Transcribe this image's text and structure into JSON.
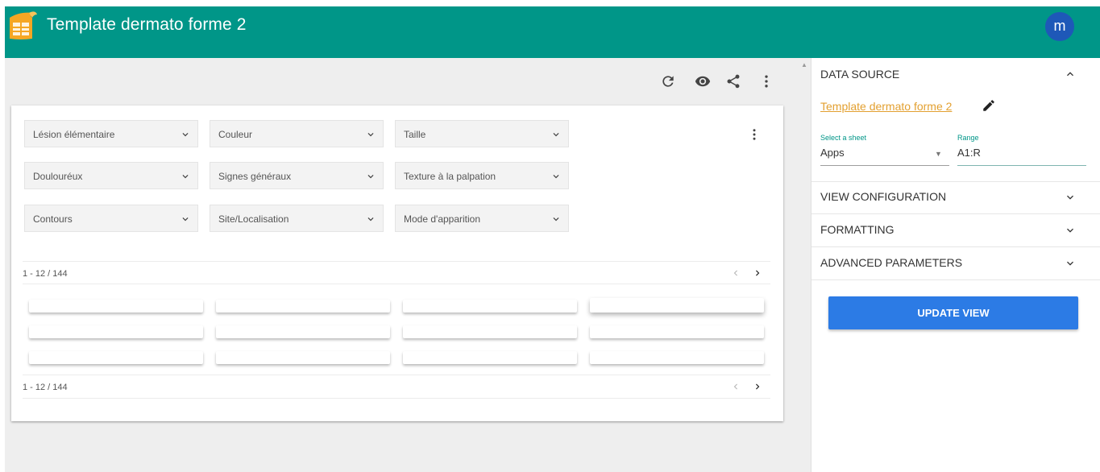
{
  "app": {
    "title": "Template dermato forme 2",
    "avatar_initial": "m",
    "brand_color": "#009688",
    "logo_color": "#f5a623"
  },
  "toolbar": {
    "icons": [
      "refresh-icon",
      "eye-icon",
      "share-icon",
      "more-vert-icon"
    ]
  },
  "filters": [
    {
      "label": "Lésion élémentaire"
    },
    {
      "label": "Couleur"
    },
    {
      "label": "Taille"
    },
    {
      "label": "Doulouréux"
    },
    {
      "label": "Signes généraux"
    },
    {
      "label": "Texture à la palpation"
    },
    {
      "label": "Contours"
    },
    {
      "label": "Site/Localisation"
    },
    {
      "label": "Mode d'apparition"
    }
  ],
  "pagination": {
    "top": "1 - 12 / 144",
    "bottom": "1 - 12 / 144"
  },
  "sidebar": {
    "data_source": {
      "header": "DATA SOURCE",
      "link": "Template dermato forme 2",
      "sheet_label": "Select a sheet",
      "sheet_value": "Apps",
      "range_label": "Range",
      "range_value": "A1:R"
    },
    "sections": [
      "VIEW CONFIGURATION",
      "FORMATTING",
      "ADVANCED PARAMETERS"
    ],
    "update_button": "UPDATE VIEW",
    "accent_color": "#2c7be5"
  }
}
